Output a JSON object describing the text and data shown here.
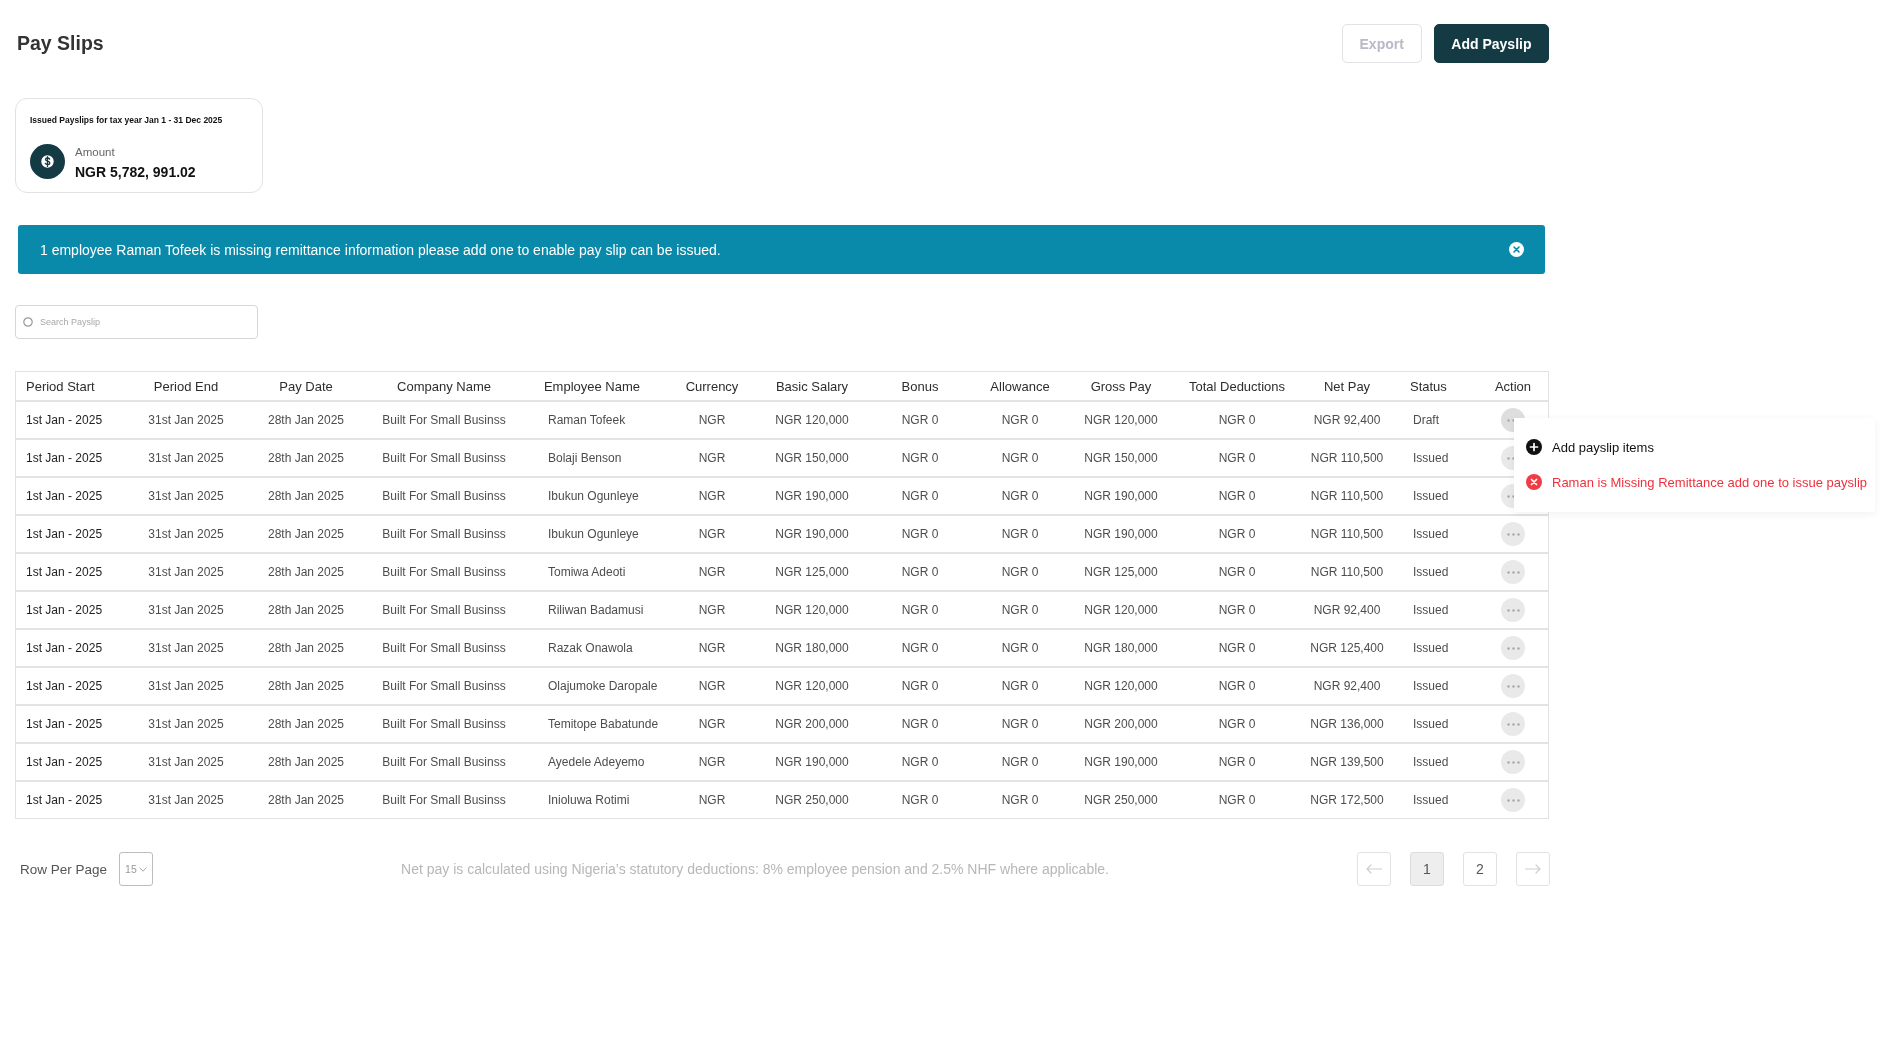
{
  "page": {
    "title": "Pay Slips"
  },
  "actions": [
    {
      "label": "Export",
      "kind": "outline",
      "disabled": true
    },
    {
      "label": "Add Payslip",
      "kind": "primary",
      "disabled": false
    }
  ],
  "summary_card": {
    "title": "Issued Payslips for tax year Jan 1 - 31 Dec 2025",
    "label": "Amount",
    "value": "NGR 5,782, 991.02"
  },
  "alert": {
    "message": "1 employee Raman Tofeek is missing remittance information please add one to enable pay slip can be issued."
  },
  "search": {
    "placeholder": "Search Payslip"
  },
  "table": {
    "columns": [
      "Period Start",
      "Period End",
      "Pay Date",
      "Company Name",
      "Employee Name",
      "Currency",
      "Basic Salary",
      "Bonus",
      "Allowance",
      "Gross Pay",
      "Total Deductions",
      "Net Pay",
      "Status",
      "Action"
    ],
    "rows": [
      {
        "cells": [
          "1st Jan - 2025",
          "31st Jan 2025",
          "28th Jan 2025",
          "Built For Small Businss",
          "Raman Tofeek",
          "NGR",
          "NGR 120,000",
          "NGR 0",
          "NGR 0",
          "NGR 120,000",
          "NGR 0",
          "NGR 92,400",
          "Draft"
        ],
        "menu_expanded": true
      },
      {
        "cells": [
          "1st Jan - 2025",
          "31st Jan 2025",
          "28th Jan 2025",
          "Built For Small Businss",
          "Bolaji Benson",
          "NGR",
          "NGR 150,000",
          "NGR 0",
          "NGR 0",
          "NGR 150,000",
          "NGR 0",
          "NGR 110,500",
          "Issued"
        ],
        "menu_expanded": false
      },
      {
        "cells": [
          "1st Jan - 2025",
          "31st Jan 2025",
          "28th Jan 2025",
          "Built For Small Businss",
          "Ibukun Ogunleye",
          "NGR",
          "NGR 190,000",
          "NGR 0",
          "NGR 0",
          "NGR 190,000",
          "NGR 0",
          "NGR 110,500",
          "Issued"
        ],
        "menu_expanded": false
      },
      {
        "cells": [
          "1st Jan - 2025",
          "31st Jan 2025",
          "28th Jan 2025",
          "Built For Small Businss",
          "Ibukun Ogunleye",
          "NGR",
          "NGR 190,000",
          "NGR 0",
          "NGR 0",
          "NGR 190,000",
          "NGR 0",
          "NGR 110,500",
          "Issued"
        ],
        "menu_expanded": false
      },
      {
        "cells": [
          "1st Jan - 2025",
          "31st Jan 2025",
          "28th Jan 2025",
          "Built For Small Businss",
          "Tomiwa Adeoti",
          "NGR",
          "NGR 125,000",
          "NGR 0",
          "NGR 0",
          "NGR 125,000",
          "NGR 0",
          "NGR 110,500",
          "Issued"
        ],
        "menu_expanded": false
      },
      {
        "cells": [
          "1st Jan - 2025",
          "31st Jan 2025",
          "28th Jan 2025",
          "Built For Small Businss",
          "Riliwan Badamusi",
          "NGR",
          "NGR 120,000",
          "NGR 0",
          "NGR 0",
          "NGR 120,000",
          "NGR 0",
          "NGR 92,400",
          "Issued"
        ],
        "menu_expanded": false
      },
      {
        "cells": [
          "1st Jan - 2025",
          "31st Jan 2025",
          "28th Jan 2025",
          "Built For Small Businss",
          "Razak Onawola",
          "NGR",
          "NGR 180,000",
          "NGR 0",
          "NGR 0",
          "NGR 180,000",
          "NGR 0",
          "NGR 125,400",
          "Issued"
        ],
        "menu_expanded": false
      },
      {
        "cells": [
          "1st Jan - 2025",
          "31st Jan 2025",
          "28th Jan 2025",
          "Built For Small Businss",
          "Olajumoke Daropale",
          "NGR",
          "NGR 120,000",
          "NGR 0",
          "NGR 0",
          "NGR 120,000",
          "NGR 0",
          "NGR 92,400",
          "Issued"
        ],
        "menu_expanded": false
      },
      {
        "cells": [
          "1st Jan - 2025",
          "31st Jan 2025",
          "28th Jan 2025",
          "Built For Small Businss",
          "Temitope Babatunde",
          "NGR",
          "NGR 200,000",
          "NGR 0",
          "NGR 0",
          "NGR 200,000",
          "NGR 0",
          "NGR 136,000",
          "Issued"
        ],
        "menu_expanded": false
      },
      {
        "cells": [
          "1st Jan - 2025",
          "31st Jan 2025",
          "28th Jan 2025",
          "Built For Small Businss",
          "Ayedele Adeyemo",
          "NGR",
          "NGR 190,000",
          "NGR 0",
          "NGR 0",
          "NGR 190,000",
          "NGR 0",
          "NGR 139,500",
          "Issued"
        ],
        "menu_expanded": false
      },
      {
        "cells": [
          "1st Jan - 2025",
          "31st Jan 2025",
          "28th Jan 2025",
          "Built For Small Businss",
          "Inioluwa Rotimi",
          "NGR",
          "NGR 250,000",
          "NGR 0",
          "NGR 0",
          "NGR 250,000",
          "NGR 0",
          "NGR 172,500",
          "Issued"
        ],
        "menu_expanded": false
      }
    ],
    "action_menu": {
      "items": [
        {
          "kind": "action",
          "label": "Add payslip items"
        },
        {
          "kind": "error",
          "label": "Raman is Missing Remittance add one to issue payslip"
        }
      ]
    }
  },
  "footer": {
    "rows_per_page_label": "Row Per Page",
    "rows_per_page": "15",
    "note": "Net pay is calculated using Nigeria’s statutory deductions: 8% employee pension and 2.5% NHF where applicable.",
    "pages": [
      {
        "label": "1",
        "selected": true
      },
      {
        "label": "2",
        "selected": false
      }
    ]
  }
}
